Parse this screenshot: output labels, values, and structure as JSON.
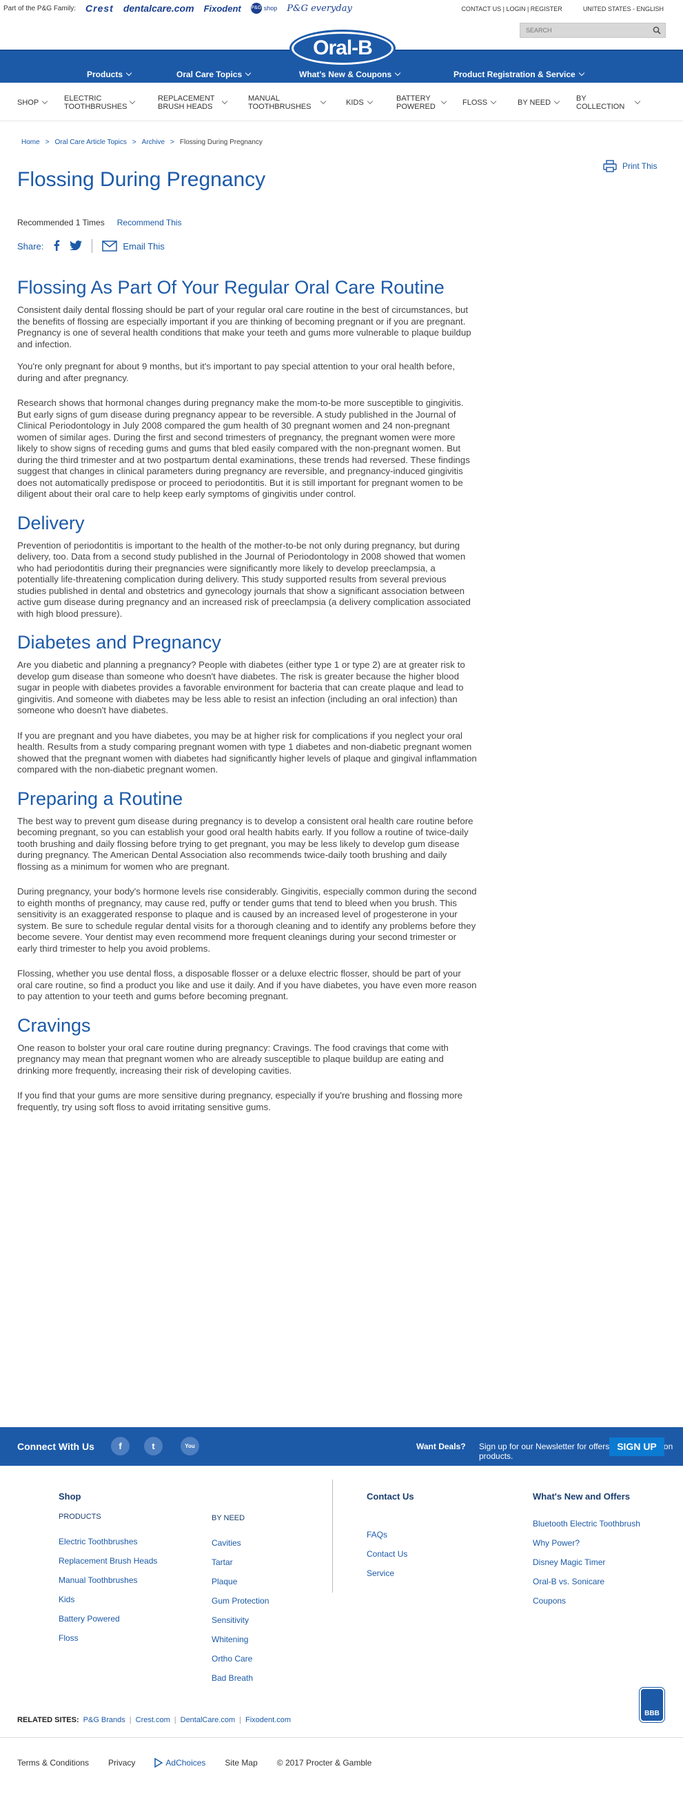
{
  "topbar": {
    "family_label": "Part of the P&G Family:",
    "brands": [
      "Crest",
      "dentalcare.com",
      "Fixodent",
      "P&G",
      "shop",
      "P&G everyday"
    ],
    "contact_login": "CONTACT US | LOGIN | REGISTER",
    "region": "UNITED STATES - ENGLISH",
    "search_placeholder": "SEARCH"
  },
  "logo": "Oral-B",
  "main_nav": [
    "Products",
    "Oral Care Topics",
    "What's New & Coupons",
    "Product Registration & Service"
  ],
  "category_nav": [
    {
      "label": "SHOP"
    },
    {
      "label": "ELECTRIC TOOTHBRUSHES"
    },
    {
      "label": "REPLACEMENT BRUSH HEADS"
    },
    {
      "label": "MANUAL TOOTHBRUSHES"
    },
    {
      "label": "KIDS"
    },
    {
      "label": "BATTERY POWERED"
    },
    {
      "label": "FLOSS"
    },
    {
      "label": "BY NEED"
    },
    {
      "label": "BY COLLECTION"
    }
  ],
  "breadcrumb": [
    "Home",
    ">",
    "Oral Care Article Topics",
    ">",
    "Archive",
    ">",
    "Flossing During Pregnancy"
  ],
  "print_label": "Print This",
  "page_title": "Flossing During Pregnancy",
  "recommended": "Recommended 1 Times",
  "recommend_link": "Recommend This",
  "share_label": "Share:",
  "email_label": "Email This",
  "article": {
    "h1": "Flossing As Part Of Your Regular Oral Care Routine",
    "p1": "Consistent daily dental flossing should be part of your regular oral care routine in the best of circumstances, but the benefits of flossing are especially important if you are thinking of becoming pregnant or if you are pregnant. Pregnancy is one of several health conditions that make your teeth and gums more vulnerable to plaque buildup and infection.",
    "p2": "You're only pregnant for about 9 months, but it's important to pay special attention to your oral health before, during and after pregnancy.",
    "p3": "Research shows that hormonal changes during pregnancy make the mom-to-be more susceptible to gingivitis. But early signs of gum disease during pregnancy appear to be reversible. A study published in the Journal of Clinical Periodontology in July 2008 compared the gum health of 30 pregnant women and 24 non-pregnant women of similar ages. During the first and second trimesters of pregnancy, the pregnant women were more likely to show signs of receding gums and gums that bled easily compared with the non-pregnant women. But during the third trimester and at two postpartum dental examinations, these trends had reversed. These findings suggest that changes in clinical parameters during pregnancy are reversible, and pregnancy-induced gingivitis does not automatically predispose or proceed to periodontitis. But it is still important for pregnant women to be diligent about their oral care to help keep early symptoms of gingivitis under control.",
    "h2": "Delivery",
    "p4": "Prevention of periodontitis is important to the health of the mother-to-be not only during pregnancy, but during delivery, too. Data from a second study published in the Journal of Periodontology in 2008 showed that women who had periodontitis during their pregnancies were significantly more likely to develop preeclampsia, a potentially life-threatening complication during delivery. This study supported results from several previous studies published in dental and obstetrics and gynecology journals that show a significant association between active gum disease during pregnancy and an increased risk of preeclampsia (a delivery complication associated with high blood pressure).",
    "h3": "Diabetes and Pregnancy",
    "p5": "Are you diabetic and planning a pregnancy? People with diabetes (either type 1 or type 2) are at greater risk to develop gum disease than someone who doesn't have diabetes. The risk is greater because the higher blood sugar in people with diabetes provides a favorable environment for bacteria that can create plaque and lead to gingivitis. And someone with diabetes may be less able to resist an infection (including an oral infection) than someone who doesn't have diabetes.",
    "p6": "If you are pregnant and you have diabetes, you may be at higher risk for complications if you neglect your oral health. Results from a study comparing pregnant women with type 1 diabetes and non-diabetic pregnant women showed that the pregnant women with diabetes had significantly higher levels of plaque and gingival inflammation compared with the non-diabetic pregnant women.",
    "h4": "Preparing a Routine",
    "p7": "The best way to prevent gum disease during pregnancy is to develop a consistent oral health care routine before becoming pregnant, so you can establish your good oral health habits early. If you follow a routine of twice-daily tooth brushing and daily flossing before trying to get pregnant, you may be less likely to develop gum disease during pregnancy. The American Dental Association also recommends twice-daily tooth brushing and daily flossing as a minimum for women who are pregnant.",
    "p8": "During pregnancy, your body's hormone levels rise considerably. Gingivitis, especially common during the second to eighth months of pregnancy, may cause red, puffy or tender gums that tend to bleed when you brush. This sensitivity is an exaggerated response to plaque and is caused by an increased level of progesterone in your system. Be sure to schedule regular dental visits for a thorough cleaning and to identify any problems before they become severe. Your dentist may even recommend more frequent cleanings during your second trimester or early third trimester to help you avoid problems.",
    "p9": "Flossing, whether you use dental floss, a disposable flosser or a deluxe electric flosser, should be part of your oral care routine, so find a product you like and use it daily. And if you have diabetes, you have even more reason to pay attention to your teeth and gums before becoming pregnant.",
    "h5": "Cravings",
    "p10": "One reason to bolster your oral care routine during pregnancy: Cravings. The food cravings that come with pregnancy may mean that pregnant women who are already susceptible to plaque buildup are eating and drinking more frequently, increasing their risk of developing cavities.",
    "p11": "If you find that your gums are more sensitive during pregnancy, especially if you're brushing and flossing more frequently, try using soft floss to avoid irritating sensitive gums."
  },
  "connect": {
    "label": "Connect With Us",
    "social": [
      "f",
      "t",
      "You"
    ],
    "deals": "Want Deals?",
    "newsletter": "Sign up for our Newsletter for offers and the latest on products.",
    "signup": "SIGN UP"
  },
  "footer": {
    "shop_title": "Shop",
    "products_title": "PRODUCTS",
    "products": [
      "Electric Toothbrushes",
      "Replacement Brush Heads",
      "Manual Toothbrushes",
      "Kids",
      "Battery Powered",
      "Floss"
    ],
    "byneed_title": "BY NEED",
    "byneed": [
      "Cavities",
      "Tartar",
      "Plaque",
      "Gum Protection",
      "Sensitivity",
      "Whitening",
      "Ortho Care",
      "Bad Breath"
    ],
    "contact_title": "Contact Us",
    "contact": [
      "FAQs",
      "Contact Us",
      "Service"
    ],
    "whatsnew_title": "What's New and Offers",
    "whatsnew": [
      "Bluetooth Electric Toothbrush",
      "Why Power?",
      "Disney Magic Timer",
      "Oral-B vs. Sonicare",
      "Coupons"
    ],
    "bbb": "BBB",
    "related_label": "RELATED SITES:",
    "related": [
      "P&G Brands",
      "Crest.com",
      "DentalCare.com",
      "Fixodent.com"
    ],
    "legal": [
      "Terms & Conditions",
      "Privacy",
      "AdChoices",
      "Site Map",
      "© 2017 Procter & Gamble"
    ]
  }
}
